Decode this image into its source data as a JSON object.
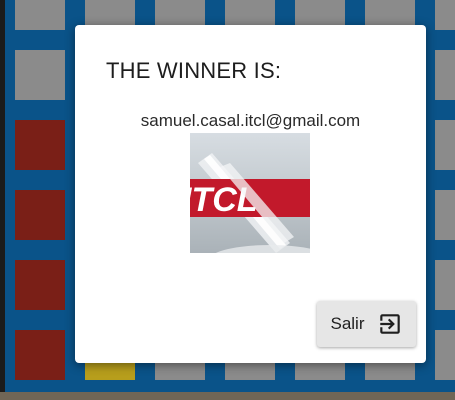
{
  "dialog": {
    "title": "THE WINNER IS:",
    "winner_email": "samuel.casal.itcl@gmail.com",
    "avatar_text": "ITCL",
    "exit_button": {
      "label": "Salir",
      "icon": "exit-to-app-icon"
    }
  },
  "board": {
    "colors": {
      "border": "#0a5389",
      "empty_cell": "#8b8b8b",
      "red_piece": "#7a1f17",
      "yellow_piece": "#b79e1c"
    }
  }
}
